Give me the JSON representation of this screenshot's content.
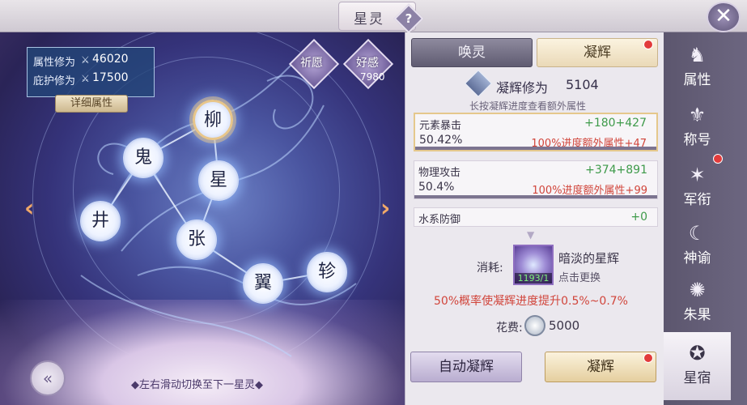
{
  "header": {
    "title": "星灵",
    "help_glyph": "?",
    "close_glyph": "✕"
  },
  "starmap": {
    "stats": [
      {
        "label": "属性修为",
        "value": "46020"
      },
      {
        "label": "庇护修为",
        "value": "17500"
      }
    ],
    "detail_button": "详细属性",
    "wish_button": "祈愿",
    "favor_button": "好感",
    "favor_value": "7980",
    "stars": [
      "柳",
      "鬼",
      "星",
      "井",
      "张",
      "翼",
      "轸"
    ],
    "hint": "◆左右滑动切换至下一星灵◆",
    "prev_arrow": "‹",
    "next_arrow": "›"
  },
  "panel": {
    "tabs": {
      "huanling": "唤灵",
      "ninghui": "凝辉"
    },
    "level_label": "凝辉修为",
    "level_value": "5104",
    "level_tip": "长按凝辉进度查看额外属性",
    "attributes": [
      {
        "name": "元素暴击",
        "pct": "50.42%",
        "gain": "+180+427",
        "note": "100%进度额外属性+47",
        "progress": 1.0
      },
      {
        "name": "物理攻击",
        "pct": "50.4%",
        "gain": "+374+891",
        "note": "100%进度额外属性+99",
        "progress": 1.0
      },
      {
        "name": "水系防御",
        "pct": "",
        "gain": "+0",
        "note": "",
        "progress": 0
      }
    ],
    "cost_label": "消耗:",
    "item_name": "暗淡的星辉",
    "item_count": "1193/1",
    "item_change": "点击更换",
    "chance_text": "50%概率使凝辉进度提升0.5%~0.7%",
    "fee_label": "花费:",
    "fee_value": "5000",
    "auto_button": "自动凝辉",
    "ninghui_button": "凝辉"
  },
  "sidebar": {
    "items": [
      {
        "label": "属性",
        "icon": "wolf-crest-icon"
      },
      {
        "label": "称号",
        "icon": "sword-emblem-icon"
      },
      {
        "label": "军衔",
        "icon": "star-rank-icon"
      },
      {
        "label": "神谕",
        "icon": "moon-sun-icon"
      },
      {
        "label": "朱果",
        "icon": "swirl-fruit-icon"
      },
      {
        "label": "星宿",
        "icon": "star-wheel-icon"
      }
    ]
  },
  "colors": {
    "accent_gold": "#e5c88c",
    "alert_red": "#e23b3b",
    "gain_green": "#3e9a4a",
    "note_red": "#d1453b"
  }
}
